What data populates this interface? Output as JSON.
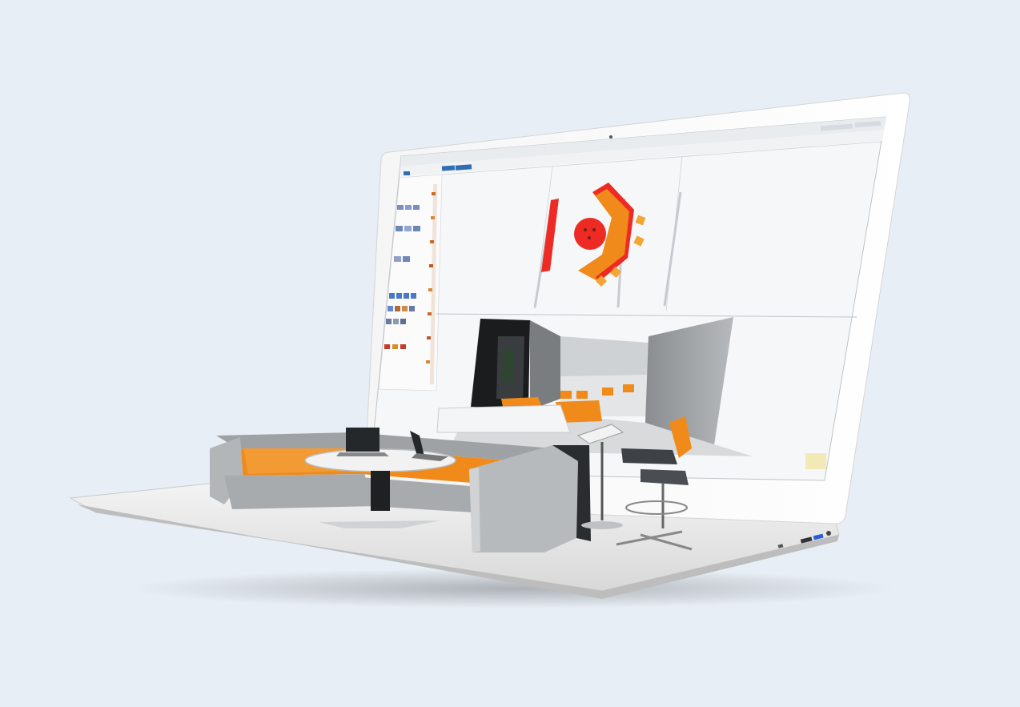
{
  "window": {
    "title": "",
    "user_area": "",
    "ribbon_tabs": [
      {
        "label": ""
      },
      {
        "label": ""
      }
    ]
  },
  "viewports": {
    "top_view": "floor-plan",
    "bottom_view": "3d-render"
  },
  "colors": {
    "background": "#e8eef5",
    "accent_orange": "#f08a1a",
    "accent_red": "#ee2a24",
    "furniture_gray": "#9ea2a5",
    "ribbon_blue": "#2f6db5"
  },
  "icons": [
    "webcam-icon",
    "usb-port-icon",
    "headphone-jack-icon"
  ]
}
